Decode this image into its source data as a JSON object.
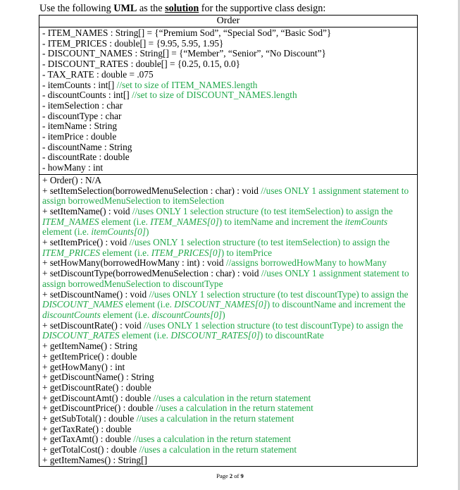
{
  "intro": {
    "before": "Use the following ",
    "uml": "UML",
    "middle": " as the ",
    "solution": "solution",
    "after": " for the supportive class design:"
  },
  "class_name": "Order",
  "attributes": [
    {
      "sig": "- ITEM_NAMES : String[] = {“Premium Sod”, “Special Sod”, “Basic Sod”}",
      "comment": ""
    },
    {
      "sig": "- ITEM_PRICES : double[] = {9.95, 5.95, 1.95}",
      "comment": ""
    },
    {
      "sig": "- DISCOUNT_NAMES : String[] = {“Member”, “Senior”, “No Discount”}",
      "comment": ""
    },
    {
      "sig": "- DISCOUNT_RATES : double[] = {0.25, 0.15, 0.0}",
      "comment": ""
    },
    {
      "sig": "- TAX_RATE : double = .075",
      "comment": ""
    },
    {
      "sig": "- itemCounts : int[] ",
      "comment": "//set to size of ITEM_NAMES.length"
    },
    {
      "sig": "- discountCounts : int[] ",
      "comment": "//set to size of DISCOUNT_NAMES.length"
    },
    {
      "sig": "- itemSelection : char",
      "comment": ""
    },
    {
      "sig": "- discountType : char",
      "comment": ""
    },
    {
      "sig": "- itemName : String",
      "comment": ""
    },
    {
      "sig": "- itemPrice : double",
      "comment": ""
    },
    {
      "sig": "- discountName : String",
      "comment": ""
    },
    {
      "sig": "- discountRate : double",
      "comment": ""
    },
    {
      "sig": "- howMany : int",
      "comment": ""
    }
  ],
  "methods": {
    "m0": {
      "sig": "+ Order() : N/A"
    },
    "m1": {
      "sig": "+ setItemSelection(borrowedMenuSelection : char) : void ",
      "c1": "//uses ONLY 1 assignment statement to assign borrowedMenuSelection to itemSelection"
    },
    "m2": {
      "sig": "+ setItemName() : void ",
      "c1": "//uses ONLY 1 selection structure (to test itemSelection) to assign the ",
      "i1": "ITEM_NAMES",
      "c2": " element (i.e. ",
      "i2": "ITEM_NAMES[0]",
      "c3": ") to itemName and increment the ",
      "i3": "itemCounts",
      "c4": " element (i.e. ",
      "i4": "itemCounts[0]",
      "c5": ")"
    },
    "m3": {
      "sig": "+ setItemPrice() : void ",
      "c1": "//uses ONLY 1 selection structure (to test itemSelection) to assign the ",
      "i1": "ITEM_PRICES",
      "c2": " element (i.e. ",
      "i2": "ITEM_PRICES[0]",
      "c3": ") to itemPrice"
    },
    "m4": {
      "sig": "+ setHowMany(borrowedHowMany : int) : void ",
      "c1": "//assigns borrowedHowMany to howMany"
    },
    "m5": {
      "sig": "+ setDiscountType(borrowedMenuSelection : char) : void ",
      "c1": "//uses ONLY 1 assignment statement to assign borrowedMenuSelection to discountType"
    },
    "m6": {
      "sig": "+ setDiscountName() : void ",
      "c1": "//uses ONLY 1 selection structure  (to test discountType) to assign the ",
      "i1": "DISCOUNT_NAMES",
      "c2": " element (i.e. ",
      "i2": "DISCOUNT_NAMES[0]",
      "c3": ") to discountName and increment the ",
      "i3": "discountCounts",
      "c4": " element (i.e. ",
      "i4": "discountCounts[0]",
      "c5": ")"
    },
    "m7": {
      "sig": "+ setDiscountRate() : void ",
      "c1": "//uses ONLY 1 selection structure  (to test discountType) to assign the ",
      "i1": "DISCOUNT_RATES",
      "c2": " element (i.e. ",
      "i2": "DISCOUNT_RATES[0]",
      "c3": ") to discountRate"
    },
    "m8": {
      "sig": "+ getItemName() : String"
    },
    "m9": {
      "sig": "+ getItemPrice() : double"
    },
    "m10": {
      "sig": "+ getHowMany() : int"
    },
    "m11": {
      "sig": "+ getDiscountName() : String"
    },
    "m12": {
      "sig": "+ getDiscountRate() : double"
    },
    "m13": {
      "sig": "+ getDiscountAmt() : double ",
      "c1": "//uses a calculation in the return statement"
    },
    "m14": {
      "sig": "+ getDiscountPrice() : double ",
      "c1": "//uses a calculation in the return statement"
    },
    "m15": {
      "sig": "+ getSubTotal() : double ",
      "c1": "//uses a calculation in the return statement"
    },
    "m16": {
      "sig": "+ getTaxRate() : double"
    },
    "m17": {
      "sig": "+ getTaxAmt() : double ",
      "c1": "//uses a calculation in the return statement"
    },
    "m18": {
      "sig": "+ getTotalCost() : double ",
      "c1": "//uses a calculation in the return statement"
    },
    "m19": {
      "sig": "+ getItemNames() : String[]"
    }
  },
  "footer": {
    "page_label": "Page ",
    "page_num": "2",
    "of_label": " of ",
    "page_total": "9"
  },
  "colors": {
    "comment_green": "#22a84b",
    "text": "#000000",
    "scrollbar": "#d4d4d4"
  }
}
